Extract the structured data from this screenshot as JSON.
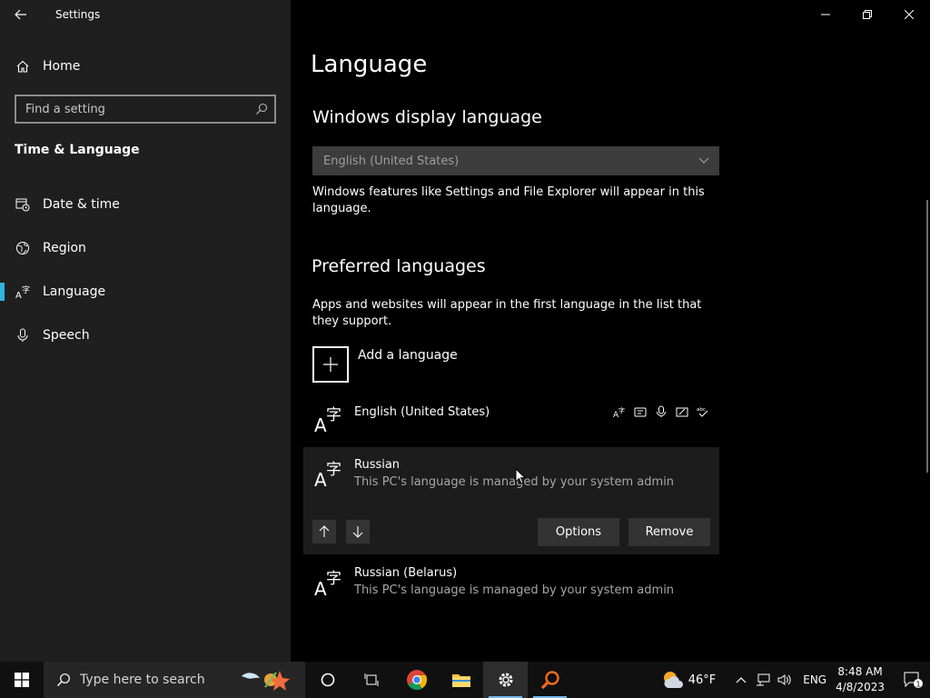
{
  "window": {
    "title": "Settings"
  },
  "sidebar": {
    "home_label": "Home",
    "search_placeholder": "Find a setting",
    "section_title": "Time & Language",
    "items": [
      {
        "label": "Date & time",
        "icon": "calendar-clock-icon"
      },
      {
        "label": "Region",
        "icon": "globe-icon"
      },
      {
        "label": "Language",
        "icon": "language-icon",
        "active": true
      },
      {
        "label": "Speech",
        "icon": "microphone-icon"
      }
    ]
  },
  "main": {
    "page_title": "Language",
    "display_language": {
      "heading": "Windows display language",
      "selected": "English (United States)",
      "description": "Windows features like Settings and File Explorer will appear in this language."
    },
    "preferred": {
      "heading": "Preferred languages",
      "description": "Apps and websites will appear in the first language in the list that they support.",
      "add_label": "Add a language",
      "languages": [
        {
          "name": "English (United States)",
          "sub": ""
        },
        {
          "name": "Russian",
          "sub": "This PC's language is managed by your system admin"
        },
        {
          "name": "Russian (Belarus)",
          "sub": "This PC's language is managed by your system admin"
        }
      ],
      "options_label": "Options",
      "remove_label": "Remove"
    }
  },
  "taskbar": {
    "search_placeholder": "Type here to search",
    "weather_temp": "46°F",
    "input_language": "ENG",
    "time": "8:48 AM",
    "date": "4/8/2023",
    "notification_count": "1"
  },
  "colors": {
    "accent": "#2fb3e0",
    "sidebar_bg": "#1f1f1f",
    "main_bg": "#000000"
  }
}
